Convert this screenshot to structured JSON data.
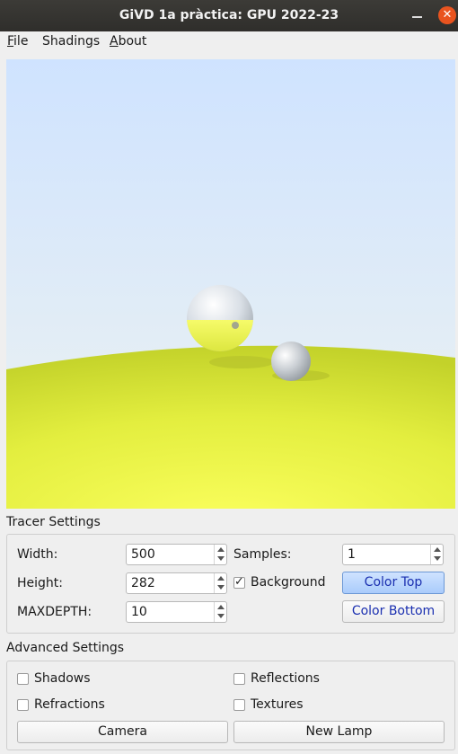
{
  "window": {
    "title": "GiVD 1a pràctica: GPU 2022-23",
    "close_glyph": "✕"
  },
  "menu": {
    "file": {
      "mnemonic": "F",
      "rest": "ile"
    },
    "shadings": {
      "label": "Shadings"
    },
    "about": {
      "mnemonic": "A",
      "rest": "bout"
    }
  },
  "scene": {
    "sky_top": "#cfe3ff",
    "sky_bottom": "#e9f2f6",
    "ground_near": "#f4fb5a",
    "ground_far": "#cad82c"
  },
  "tracer": {
    "title": "Tracer Settings",
    "width_label": "Width:",
    "width_value": "500",
    "height_label": "Height:",
    "height_value": "282",
    "maxdepth_label": "MAXDEPTH:",
    "maxdepth_value": "10",
    "samples_label": "Samples:",
    "samples_value": "1",
    "background_label": "Background",
    "background_checked": true,
    "color_top_label": "Color Top",
    "color_bottom_label": "Color Bottom"
  },
  "advanced": {
    "title": "Advanced Settings",
    "shadows_label": "Shadows",
    "reflections_label": "Reflections",
    "refractions_label": "Refractions",
    "textures_label": "Textures",
    "camera_label": "Camera",
    "new_lamp_label": "New Lamp"
  }
}
